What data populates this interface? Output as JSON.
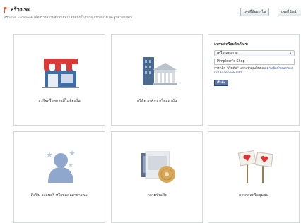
{
  "header": {
    "title": "สร้างเพจ",
    "subtitle": "สร้างเพจ Facebook เพื่อสร้างความสัมพันธ์ที่ใกล้ชิดยิ่งขึ้นกับกลุ่มเป้าหมายและลูกค้าของคุณ",
    "buttons": [
      "เพจที่น้อยเกไซ",
      "เพจที่นับนั"
    ]
  },
  "colors": {
    "accent": "#3b5998",
    "tile_border": "#d5d8de",
    "flag": "#f15a24"
  },
  "tiles": [
    {
      "label": "ธุรกิจหรือสถานที่ในท้องถิ่น",
      "icon": "storefront-icon"
    },
    {
      "label": "บริษัท องค์กร หรือสถาบัน",
      "icon": "institution-building-icon"
    },
    {
      "label": "ศิลปิน วงดนตรี หรือบุคคลสาธารณะ",
      "icon": "public-figure-icon"
    },
    {
      "label": "ความบันเทิง",
      "icon": "entertainment-media-icon"
    },
    {
      "label": "การกุศลหรือชุมชน",
      "icon": "cause-community-icon"
    }
  ],
  "brand_panel": {
    "title": "แบรนด์หรือผลิตภัณฑ์",
    "category_value": "เครื่องแต่งกาย",
    "name_value": "Pimploen's Shop",
    "terms_prefix": "การคลิก \"เริ่มต้น\" แสดงว่าคุณยินยอม",
    "terms_link": "ตามข้อกำหนดของเพจ Facebook แล้ว",
    "start_label": "เริ่มต้น"
  }
}
